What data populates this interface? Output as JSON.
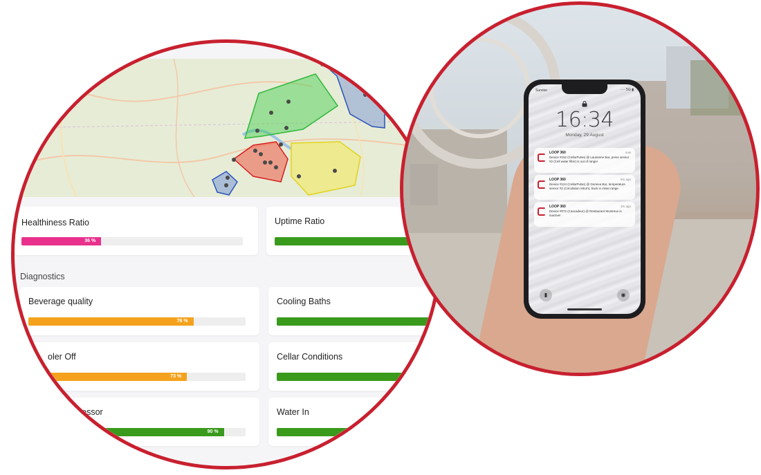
{
  "brand": {
    "accent": "#c8202f"
  },
  "health": {
    "healthiness": {
      "label": "Healthiness Ratio",
      "percent": 36,
      "value_text": "36 %",
      "color": "#e8308c"
    },
    "uptime": {
      "label": "Uptime Ratio",
      "percent": 100,
      "color": "#3a9a1c"
    }
  },
  "diagnostics": {
    "section_label": "Diagnostics",
    "items": [
      {
        "label": "Beverage quality",
        "percent": 76,
        "value_text": "76 %",
        "color": "#f4a21d"
      },
      {
        "label": "Cooling Baths",
        "percent": 100,
        "value_text": "",
        "color": "#3a9a1c"
      },
      {
        "label": "oler Off",
        "percent": 73,
        "value_text": "73 %",
        "color": "#f4a21d"
      },
      {
        "label": "Cellar Conditions",
        "percent": 100,
        "value_text": "",
        "color": "#3a9a1c"
      },
      {
        "label": "pressor",
        "percent": 90,
        "value_text": "90 %",
        "color": "#3a9a1c"
      },
      {
        "label": "Water In",
        "percent": 100,
        "value_text": "",
        "color": "#3a9a1c"
      }
    ]
  },
  "phone": {
    "carrier": "Sunrise",
    "signal": "···· 5G ▮",
    "time": "16:34",
    "date": "Monday, 29 August",
    "notifications": [
      {
        "app": "LOOP 360",
        "time": "now",
        "body": "Device #152 (CellarPulse) @ Lausanne Bar, press sensor #2 (Cell water filter) is out of range!"
      },
      {
        "app": "LOOP 360",
        "time": "8m ago",
        "body": "Device #124 (CellarPulse) @ Geneva Bar, temperature sensor #2 (Circulation return), back in clean range"
      },
      {
        "app": "LOOP 360",
        "time": "3m ago",
        "body": "Device #072 (Cascadeur) @ Restaurant Montreux is inactive!"
      }
    ]
  }
}
